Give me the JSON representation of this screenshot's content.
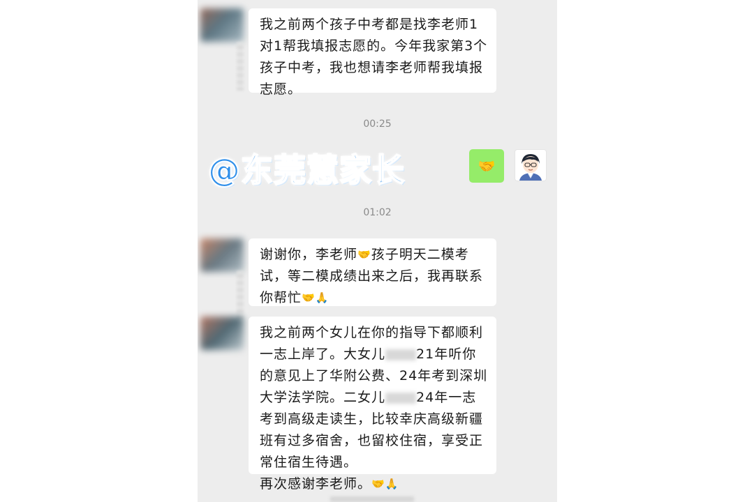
{
  "chat": {
    "messages": [
      {
        "text": "我之前两个孩子中考都是找李老师1对1帮我填报志愿的。今年我家第3个孩子中考，我也想请李老师帮我填报志愿。"
      },
      {
        "time": "00:25"
      },
      {
        "watermark": "@东莞慧家长",
        "reply_emoji": "🤝"
      },
      {
        "time": "01:02"
      },
      {
        "part1": "谢谢你，李老师",
        "emoji1": "🤝",
        "part2": "孩子明天二模考试，等二模成绩出来之后，我再联系你帮忙",
        "emoji2": "🤝🙏"
      },
      {
        "part1": "我之前两个女儿在你的指导下都顺利一志上岸了。大女儿",
        "part2": "21年听你的意见上了华附公费、24年考到深圳大学法学院。二女儿",
        "part3": "24年一志考到高级走读生，比较幸庆高级新疆班有过多宿舍，也留校住宿，享受正常住宿生待遇。",
        "thanks": "再次感谢李老师。",
        "emoji": "🤝🙏"
      }
    ]
  },
  "colors": {
    "chat_background": "#ededed",
    "bubble_white": "#ffffff",
    "bubble_green": "#95ec69",
    "watermark_blue": "#2f8fea",
    "time_gray": "#8a8a8a"
  },
  "icons": {
    "left_avatar": "blurred-avatar",
    "right_avatar": "cartoon-boy-avatar",
    "reply": "handshake-emoji"
  }
}
